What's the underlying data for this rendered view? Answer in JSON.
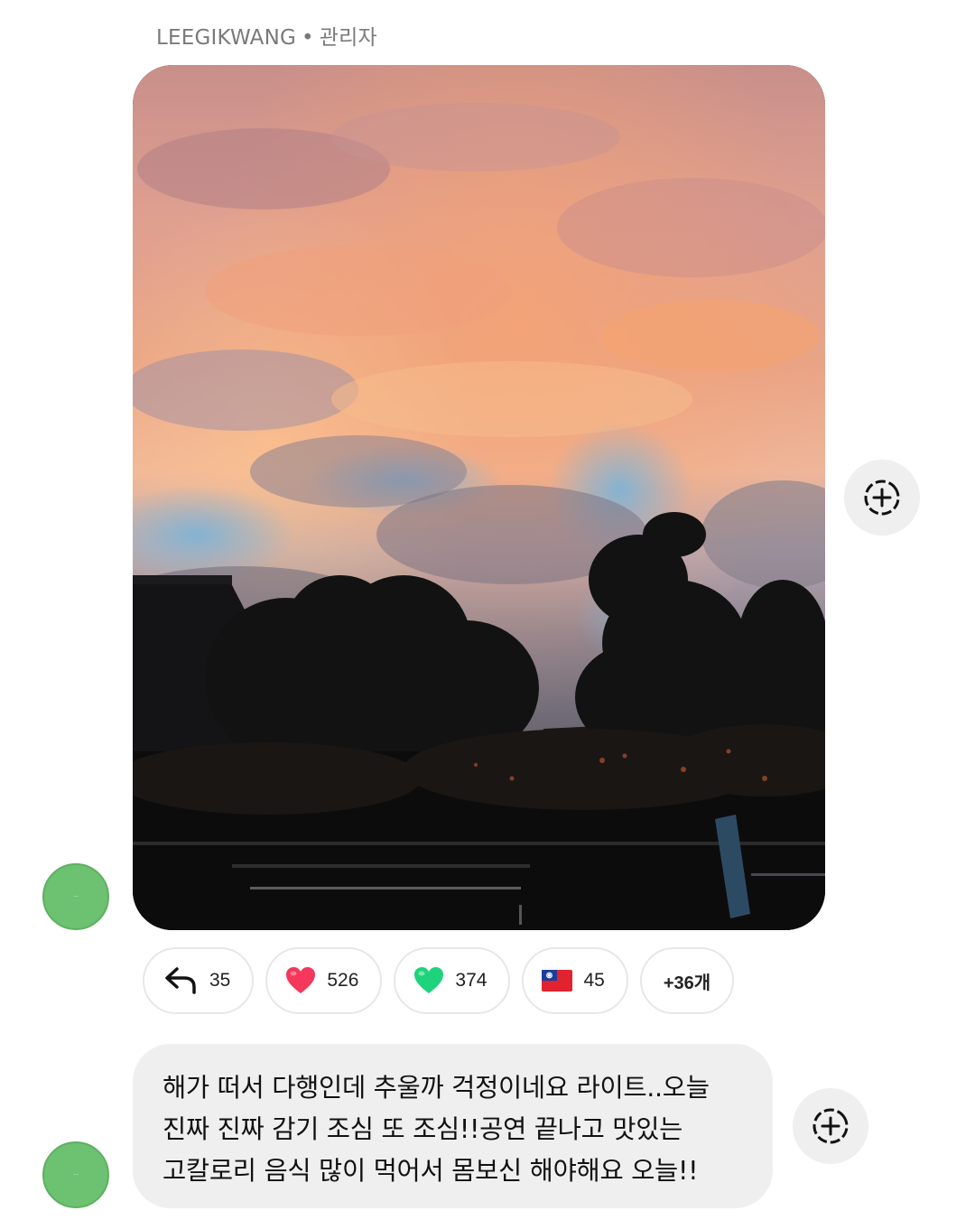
{
  "post": {
    "sender_name": "LEEGIKWANG",
    "separator": "•",
    "sender_role": "관리자",
    "photo_icon": "sunset-sky-photo"
  },
  "reactions": [
    {
      "icon": "reply-arrow-icon",
      "count": "35"
    },
    {
      "icon": "red-heart-icon",
      "count": "526"
    },
    {
      "icon": "green-heart-icon",
      "count": "374"
    },
    {
      "icon": "taiwan-flag-icon",
      "count": "45"
    },
    {
      "label": "+36개"
    }
  ],
  "reply": {
    "line1": "해가 떠서 다행인데 추울까 걱정이네요 라이트..오늘",
    "line2": "진짜 진짜 감기 조심 또 조심!!공연 끝나고 맛있는",
    "line3": "고칼로리 음식 많이 먹어서 몸보신 해야해요 오늘!!"
  },
  "colors": {
    "avatar": "#6cc270",
    "bubble": "#efefef",
    "chip_border": "#e7e7e7",
    "add_button": "#efefef"
  }
}
